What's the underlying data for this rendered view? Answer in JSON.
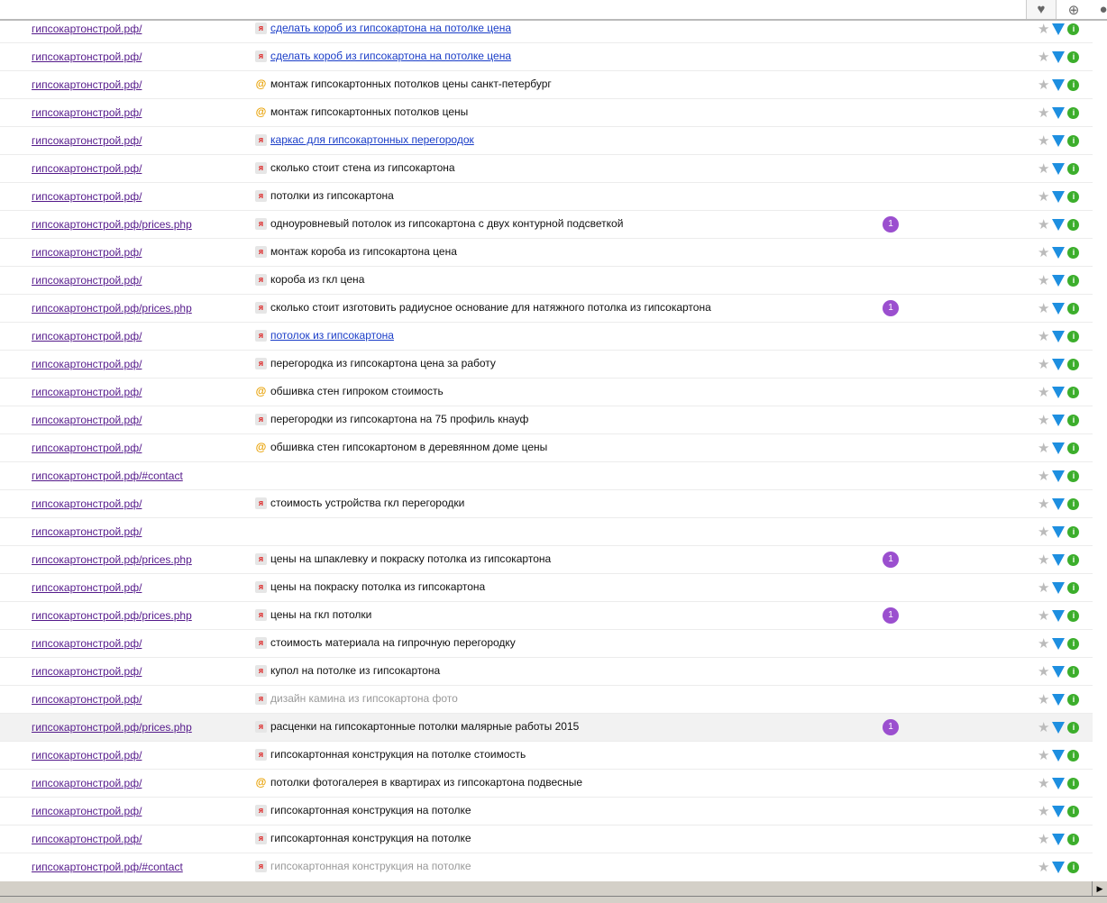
{
  "toolbar": {
    "icons": [
      "heart-icon",
      "download-icon",
      "user-icon"
    ]
  },
  "rows": [
    {
      "url": "гипсокартонстрой.рф/",
      "icon": "ya",
      "kw": "сделать короб из гипсокартона на потолке цена",
      "style": "link",
      "badge": ""
    },
    {
      "url": "гипсокартонстрой.рф/",
      "icon": "ya",
      "kw": "сделать короб из гипсокартона на потолке цена",
      "style": "link",
      "badge": ""
    },
    {
      "url": "гипсокартонстрой.рф/",
      "icon": "mail",
      "kw": "монтаж гипсокартонных потолков цены санкт-петербург",
      "style": "",
      "badge": ""
    },
    {
      "url": "гипсокартонстрой.рф/",
      "icon": "mail",
      "kw": "монтаж гипсокартонных потолков цены",
      "style": "",
      "badge": ""
    },
    {
      "url": "гипсокартонстрой.рф/",
      "icon": "ya",
      "kw": "каркас для гипсокартонных перегородок",
      "style": "link",
      "badge": ""
    },
    {
      "url": "гипсокартонстрой.рф/",
      "icon": "ya",
      "kw": "сколько стоит стена из гипсокартона",
      "style": "",
      "badge": ""
    },
    {
      "url": "гипсокартонстрой.рф/",
      "icon": "ya",
      "kw": "потолки из гипсокартона",
      "style": "",
      "badge": ""
    },
    {
      "url": "гипсокартонстрой.рф/prices.php",
      "icon": "ya",
      "kw": "одноуровневый потолок из гипсокартона с двух контурной подсветкой",
      "style": "",
      "badge": "1"
    },
    {
      "url": "гипсокартонстрой.рф/",
      "icon": "ya",
      "kw": "монтаж короба из гипсокартона цена",
      "style": "",
      "badge": ""
    },
    {
      "url": "гипсокартонстрой.рф/",
      "icon": "ya",
      "kw": "короба из гкл цена",
      "style": "",
      "badge": ""
    },
    {
      "url": "гипсокартонстрой.рф/prices.php",
      "icon": "ya",
      "kw": "сколько стоит изготовить радиусное основание для натяжного потолка из гипсокартона",
      "style": "",
      "badge": "1"
    },
    {
      "url": "гипсокартонстрой.рф/",
      "icon": "ya",
      "kw": "потолок из гипсокартона",
      "style": "link",
      "badge": ""
    },
    {
      "url": "гипсокартонстрой.рф/",
      "icon": "ya",
      "kw": "перегородка из гипсокартона цена за работу",
      "style": "",
      "badge": ""
    },
    {
      "url": "гипсокартонстрой.рф/",
      "icon": "mail",
      "kw": "обшивка стен гипроком стоимость",
      "style": "",
      "badge": ""
    },
    {
      "url": "гипсокартонстрой.рф/",
      "icon": "ya",
      "kw": "перегородки из гипсокартона на 75 профиль кнауф",
      "style": "",
      "badge": ""
    },
    {
      "url": "гипсокартонстрой.рф/",
      "icon": "mail",
      "kw": "обшивка стен гипсокартоном в деревянном доме цены",
      "style": "",
      "badge": ""
    },
    {
      "url": "гипсокартонстрой.рф/#contact",
      "icon": "",
      "kw": "",
      "style": "",
      "badge": ""
    },
    {
      "url": "гипсокартонстрой.рф/",
      "icon": "ya",
      "kw": "стоимость устройства гкл перегородки",
      "style": "",
      "badge": ""
    },
    {
      "url": "гипсокартонстрой.рф/",
      "icon": "",
      "kw": "",
      "style": "",
      "badge": ""
    },
    {
      "url": "гипсокартонстрой.рф/prices.php",
      "icon": "ya",
      "kw": "цены на шпаклевку и покраску потолка из гипсокартона",
      "style": "",
      "badge": "1"
    },
    {
      "url": "гипсокартонстрой.рф/",
      "icon": "ya",
      "kw": "цены на покраску потолка из гипсокартона",
      "style": "",
      "badge": ""
    },
    {
      "url": "гипсокартонстрой.рф/prices.php",
      "icon": "ya",
      "kw": "цены на гкл потолки",
      "style": "",
      "badge": "1"
    },
    {
      "url": "гипсокартонстрой.рф/",
      "icon": "ya",
      "kw": "стоимость материала на гипрочную перегородку",
      "style": "",
      "badge": ""
    },
    {
      "url": "гипсокартонстрой.рф/",
      "icon": "ya",
      "kw": "купол на потолке из гипсокартона",
      "style": "",
      "badge": ""
    },
    {
      "url": "гипсокартонстрой.рф/",
      "icon": "ya",
      "kw": "дизайн камина из гипсокартона фото",
      "style": "grey",
      "badge": ""
    },
    {
      "url": "гипсокартонстрой.рф/prices.php",
      "icon": "ya",
      "kw": "расценки на гипсокартонные потолки малярные работы 2015",
      "style": "",
      "badge": "1",
      "highlight": true
    },
    {
      "url": "гипсокартонстрой.рф/",
      "icon": "ya",
      "kw": "гипсокартонная конструкция на потолке стоимость",
      "style": "",
      "badge": ""
    },
    {
      "url": "гипсокартонстрой.рф/",
      "icon": "mail",
      "kw": "потолки фотогалерея в квартирах из гипсокартона подвесные",
      "style": "",
      "badge": ""
    },
    {
      "url": "гипсокартонстрой.рф/",
      "icon": "ya",
      "kw": "гипсокартонная конструкция на потолке",
      "style": "",
      "badge": ""
    },
    {
      "url": "гипсокартонстрой.рф/",
      "icon": "ya",
      "kw": "гипсокартонная конструкция на потолке",
      "style": "",
      "badge": ""
    },
    {
      "url": "гипсокартонстрой.рф/#contact",
      "icon": "ya",
      "kw": "гипсокартонная конструкция на потолке",
      "style": "grey",
      "badge": ""
    }
  ]
}
